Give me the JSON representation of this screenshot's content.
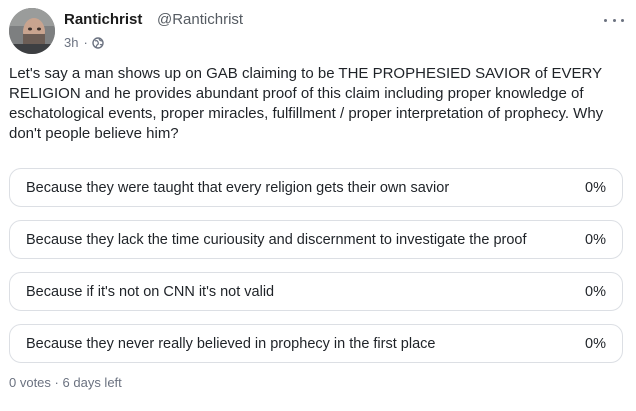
{
  "author": {
    "name": "Rantichrist",
    "handle": "@Rantichrist",
    "time": "3h",
    "visibility_icon": "globe-icon"
  },
  "post": {
    "text": "Let's say a man shows up on GAB claiming to be THE PROPHESIED SAVIOR of EVERY RELIGION and he provides abundant proof of this claim including proper knowledge of eschatological events, proper miracles, fulfillment / proper interpretation of prophecy. Why don't people believe him?"
  },
  "poll": {
    "options": [
      {
        "label": "Because they were taught that every religion gets their own savior",
        "percent": "0%"
      },
      {
        "label": "Because they lack the time curiousity and discernment to investigate the proof",
        "percent": "0%"
      },
      {
        "label": "Because if it's not on CNN it's not valid",
        "percent": "0%"
      },
      {
        "label": "Because they never really believed in prophecy in the first place",
        "percent": "0%"
      }
    ],
    "votes": "0 votes",
    "separator": "·",
    "time_left": "6 days left"
  },
  "colors": {
    "border": "#dcdfe4",
    "muted": "#6b7280",
    "text": "#1f2328"
  }
}
